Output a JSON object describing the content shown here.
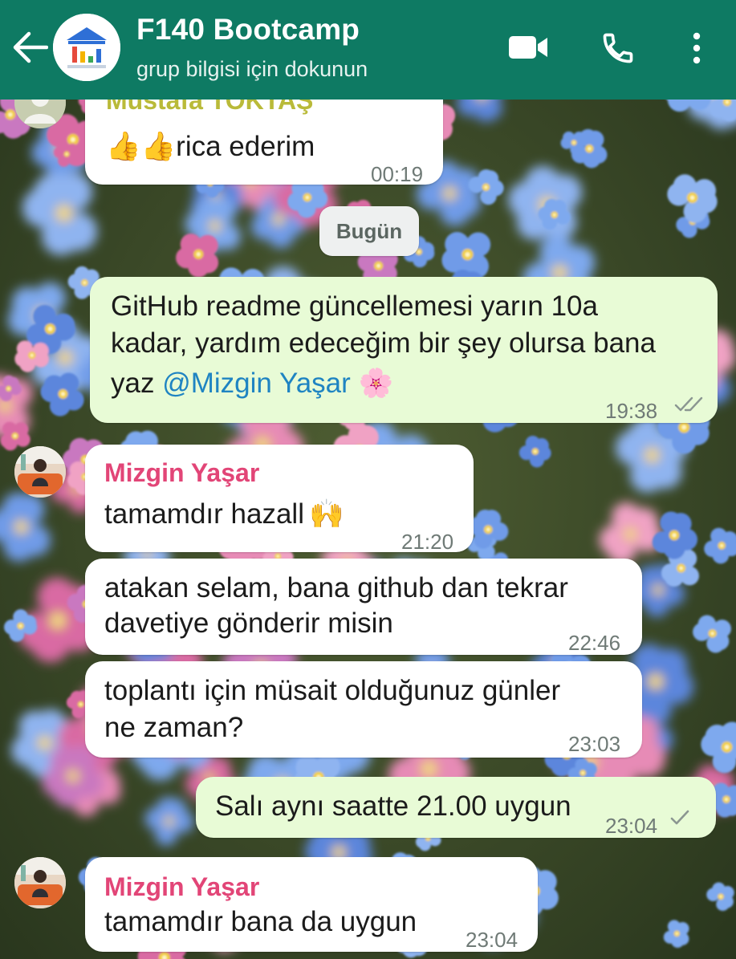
{
  "header": {
    "title": "F140 Bootcamp",
    "subtitle": "grup bilgisi için dokunun",
    "icons": [
      "back-arrow-icon",
      "group-avatar",
      "video-call-icon",
      "voice-call-icon",
      "more-menu-icon"
    ],
    "color": "#0e7a63"
  },
  "messages": [
    {
      "direction": "incoming",
      "sender": "Mustafa TOKTAŞ",
      "text": "rica ederim",
      "emoji": "👍👍",
      "time": "00:19"
    },
    {
      "type": "date-separator",
      "text": "Bugün"
    },
    {
      "direction": "outgoing",
      "lines": [
        "GitHub readme güncellemesi yarın 10a",
        "kadar, yardım edeceğim bir şey olursa bana"
      ],
      "line3_prefix": "yaz ",
      "mention": "@Mizgin Yaşar",
      "emoji": "🌸",
      "time": "19:38",
      "status": "delivered"
    },
    {
      "direction": "incoming",
      "sender": "Mizgin Yaşar",
      "text": "tamamdır hazall",
      "emoji": "🙌",
      "time": "21:20"
    },
    {
      "direction": "incoming",
      "lines": [
        "atakan selam, bana github dan tekrar",
        "davetiye gönderir misin"
      ],
      "time": "22:46"
    },
    {
      "direction": "incoming",
      "lines": [
        "toplantı için müsait olduğunuz günler",
        "ne zaman?"
      ],
      "time": "23:03"
    },
    {
      "direction": "outgoing",
      "text": "Salı aynı saatte 21.00 uygun",
      "time": "23:04",
      "status": "sent"
    },
    {
      "direction": "incoming",
      "sender": "Mizgin Yaşar",
      "text": "tamamdır bana da uygun",
      "time": "23:04"
    }
  ],
  "colors": {
    "incoming_bubble": "#ffffff",
    "outgoing_bubble": "#e8fbd6",
    "sender_name": "#e24577",
    "mention": "#1f84c2",
    "timestamp": "#6f7a76"
  }
}
